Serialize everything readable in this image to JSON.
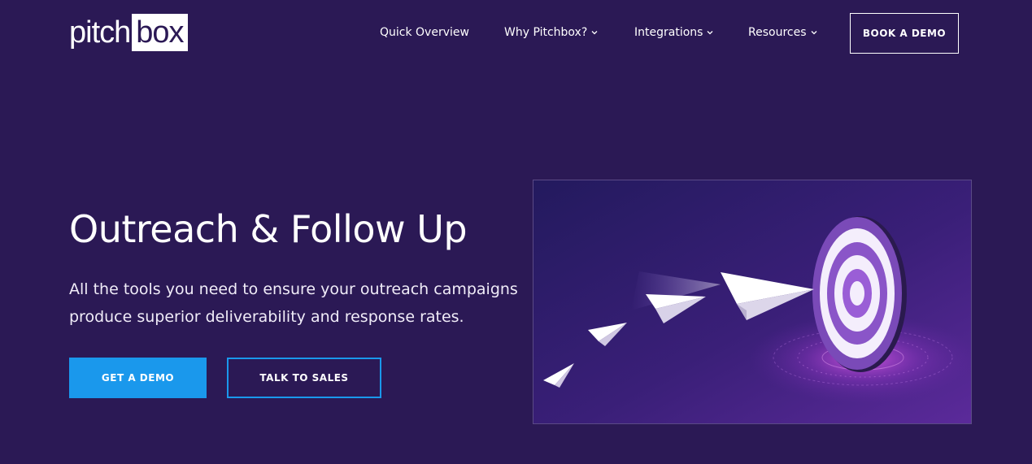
{
  "logo": {
    "part1": "pitch",
    "part2": "box"
  },
  "nav": {
    "items": [
      {
        "label": "Quick Overview",
        "has_dropdown": false
      },
      {
        "label": "Why Pitchbox?",
        "has_dropdown": true
      },
      {
        "label": "Integrations",
        "has_dropdown": true
      },
      {
        "label": "Resources",
        "has_dropdown": true
      }
    ],
    "cta_label": "BOOK A DEMO"
  },
  "hero": {
    "title": "Outreach & Follow Up",
    "subtitle": "All the tools you need to ensure your outreach campaigns produce superior deliverability and response rates.",
    "primary_button": "GET A DEMO",
    "secondary_button": "TALK TO SALES"
  },
  "colors": {
    "background": "#2b1955",
    "accent": "#1a98ec",
    "text": "#ffffff"
  },
  "icons": {
    "dropdown": "chevron-down-icon",
    "illustration": "paper-planes-flying-to-target"
  }
}
